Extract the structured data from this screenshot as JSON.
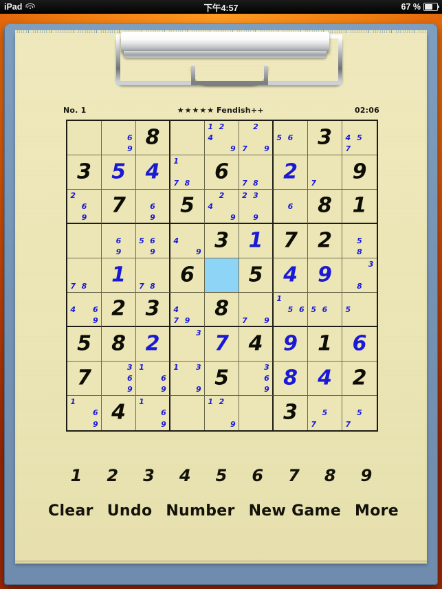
{
  "status_bar": {
    "device": "iPad",
    "wifi_icon": "wifi-icon",
    "time": "下午4:57",
    "battery_percent": "67 %",
    "battery_icon": "battery-icon"
  },
  "puzzle": {
    "number_label": "No. 1",
    "stars": "★★★★★",
    "difficulty": "Fendish++",
    "timer": "02:06",
    "selected_cell": {
      "row": 5,
      "col": 5
    },
    "colors": {
      "given": "#0d0d06",
      "user_entry": "#1a1ad6",
      "pencil_mark": "#1a1ad6",
      "selection": "#8ed4f7",
      "paper": "#ece6b6",
      "grid_line": "#1c1c14",
      "clipboard": "#7492b4",
      "desktop": "#cf4a07"
    }
  },
  "grid": [
    [
      {
        "v": null,
        "t": null,
        "m": []
      },
      {
        "v": null,
        "t": null,
        "m": [
          {
            "n": "6",
            "p": 5
          },
          {
            "n": "9",
            "p": 8
          }
        ]
      },
      {
        "v": "8",
        "t": "given",
        "m": []
      },
      {
        "v": null,
        "t": null,
        "m": []
      },
      {
        "v": null,
        "t": null,
        "m": [
          {
            "n": "1",
            "p": 0
          },
          {
            "n": "2",
            "p": 1
          },
          {
            "n": "4",
            "p": 3
          },
          {
            "n": "9",
            "p": 8
          }
        ]
      },
      {
        "v": null,
        "t": null,
        "m": [
          {
            "n": "2",
            "p": 1
          },
          {
            "n": "7",
            "p": 6
          },
          {
            "n": "9",
            "p": 8
          }
        ]
      },
      {
        "v": null,
        "t": null,
        "m": [
          {
            "n": "5",
            "p": 3
          },
          {
            "n": "6",
            "p": 4
          }
        ]
      },
      {
        "v": "3",
        "t": "given",
        "m": []
      },
      {
        "v": null,
        "t": null,
        "m": [
          {
            "n": "4",
            "p": 3
          },
          {
            "n": "5",
            "p": 4
          },
          {
            "n": "7",
            "p": 6
          }
        ]
      }
    ],
    [
      {
        "v": "3",
        "t": "given",
        "m": []
      },
      {
        "v": "5",
        "t": "user",
        "m": []
      },
      {
        "v": "4",
        "t": "user",
        "m": []
      },
      {
        "v": null,
        "t": null,
        "m": [
          {
            "n": "1",
            "p": 0
          },
          {
            "n": "7",
            "p": 6
          },
          {
            "n": "8",
            "p": 7
          }
        ]
      },
      {
        "v": "6",
        "t": "given",
        "m": []
      },
      {
        "v": null,
        "t": null,
        "m": [
          {
            "n": "7",
            "p": 6
          },
          {
            "n": "8",
            "p": 7
          }
        ]
      },
      {
        "v": "2",
        "t": "user",
        "m": []
      },
      {
        "v": null,
        "t": null,
        "m": [
          {
            "n": "7",
            "p": 6
          }
        ]
      },
      {
        "v": "9",
        "t": "given",
        "m": []
      }
    ],
    [
      {
        "v": null,
        "t": null,
        "m": [
          {
            "n": "2",
            "p": 0
          },
          {
            "n": "6",
            "p": 4
          },
          {
            "n": "9",
            "p": 7
          }
        ]
      },
      {
        "v": "7",
        "t": "given",
        "m": []
      },
      {
        "v": null,
        "t": null,
        "m": [
          {
            "n": "6",
            "p": 4
          },
          {
            "n": "9",
            "p": 7
          }
        ]
      },
      {
        "v": "5",
        "t": "given",
        "m": []
      },
      {
        "v": null,
        "t": null,
        "m": [
          {
            "n": "4",
            "p": 3
          },
          {
            "n": "2",
            "p": 1
          },
          {
            "n": "9",
            "p": 8
          }
        ]
      },
      {
        "v": null,
        "t": null,
        "m": [
          {
            "n": "2",
            "p": 0
          },
          {
            "n": "3",
            "p": 1
          },
          {
            "n": "9",
            "p": 7
          }
        ]
      },
      {
        "v": null,
        "t": null,
        "m": [
          {
            "n": "6",
            "p": 4
          }
        ]
      },
      {
        "v": "8",
        "t": "given",
        "m": []
      },
      {
        "v": "1",
        "t": "given",
        "m": []
      }
    ],
    [
      {
        "v": null,
        "t": null,
        "m": []
      },
      {
        "v": null,
        "t": null,
        "m": [
          {
            "n": "6",
            "p": 4
          },
          {
            "n": "9",
            "p": 7
          }
        ]
      },
      {
        "v": null,
        "t": null,
        "m": [
          {
            "n": "5",
            "p": 3
          },
          {
            "n": "6",
            "p": 4
          },
          {
            "n": "9",
            "p": 7
          }
        ]
      },
      {
        "v": null,
        "t": null,
        "m": [
          {
            "n": "4",
            "p": 3
          },
          {
            "n": "9",
            "p": 8
          }
        ]
      },
      {
        "v": "3",
        "t": "given",
        "m": []
      },
      {
        "v": "1",
        "t": "user",
        "m": []
      },
      {
        "v": "7",
        "t": "given",
        "m": []
      },
      {
        "v": "2",
        "t": "given",
        "m": []
      },
      {
        "v": null,
        "t": null,
        "m": [
          {
            "n": "5",
            "p": 4
          },
          {
            "n": "8",
            "p": 7
          }
        ]
      }
    ],
    [
      {
        "v": null,
        "t": null,
        "m": [
          {
            "n": "7",
            "p": 6
          },
          {
            "n": "8",
            "p": 7
          }
        ]
      },
      {
        "v": "1",
        "t": "user",
        "m": []
      },
      {
        "v": null,
        "t": null,
        "m": [
          {
            "n": "7",
            "p": 6
          },
          {
            "n": "8",
            "p": 7
          }
        ]
      },
      {
        "v": "6",
        "t": "given",
        "m": []
      },
      {
        "v": null,
        "t": null,
        "m": [],
        "sel": true
      },
      {
        "v": "5",
        "t": "given",
        "m": []
      },
      {
        "v": "4",
        "t": "user",
        "m": []
      },
      {
        "v": "9",
        "t": "user",
        "m": []
      },
      {
        "v": null,
        "t": null,
        "m": [
          {
            "n": "3",
            "p": 2
          },
          {
            "n": "8",
            "p": 7
          }
        ]
      }
    ],
    [
      {
        "v": null,
        "t": null,
        "m": [
          {
            "n": "4",
            "p": 3
          },
          {
            "n": "6",
            "p": 5
          },
          {
            "n": "9",
            "p": 8
          }
        ]
      },
      {
        "v": "2",
        "t": "given",
        "m": []
      },
      {
        "v": "3",
        "t": "given",
        "m": []
      },
      {
        "v": null,
        "t": null,
        "m": [
          {
            "n": "4",
            "p": 3
          },
          {
            "n": "7",
            "p": 6
          },
          {
            "n": "9",
            "p": 7
          }
        ]
      },
      {
        "v": "8",
        "t": "given",
        "m": []
      },
      {
        "v": null,
        "t": null,
        "m": [
          {
            "n": "7",
            "p": 6
          },
          {
            "n": "9",
            "p": 8
          }
        ]
      },
      {
        "v": null,
        "t": null,
        "m": [
          {
            "n": "1",
            "p": 0
          },
          {
            "n": "5",
            "p": 4
          },
          {
            "n": "6",
            "p": 5
          }
        ]
      },
      {
        "v": null,
        "t": null,
        "m": [
          {
            "n": "5",
            "p": 3
          },
          {
            "n": "6",
            "p": 4
          }
        ]
      },
      {
        "v": null,
        "t": null,
        "m": [
          {
            "n": "5",
            "p": 3
          }
        ]
      }
    ],
    [
      {
        "v": "5",
        "t": "given",
        "m": []
      },
      {
        "v": "8",
        "t": "given",
        "m": []
      },
      {
        "v": "2",
        "t": "user",
        "m": []
      },
      {
        "v": null,
        "t": null,
        "m": [
          {
            "n": "3",
            "p": 2
          }
        ]
      },
      {
        "v": "7",
        "t": "user",
        "m": []
      },
      {
        "v": "4",
        "t": "given",
        "m": []
      },
      {
        "v": "9",
        "t": "user",
        "m": []
      },
      {
        "v": "1",
        "t": "given",
        "m": []
      },
      {
        "v": "6",
        "t": "user",
        "m": []
      }
    ],
    [
      {
        "v": "7",
        "t": "given",
        "m": []
      },
      {
        "v": null,
        "t": null,
        "m": [
          {
            "n": "3",
            "p": 2
          },
          {
            "n": "6",
            "p": 5
          },
          {
            "n": "9",
            "p": 8
          }
        ]
      },
      {
        "v": null,
        "t": null,
        "m": [
          {
            "n": "1",
            "p": 0
          },
          {
            "n": "6",
            "p": 5
          },
          {
            "n": "9",
            "p": 8
          }
        ]
      },
      {
        "v": null,
        "t": null,
        "m": [
          {
            "n": "1",
            "p": 0
          },
          {
            "n": "3",
            "p": 2
          },
          {
            "n": "9",
            "p": 8
          }
        ]
      },
      {
        "v": "5",
        "t": "given",
        "m": []
      },
      {
        "v": null,
        "t": null,
        "m": [
          {
            "n": "3",
            "p": 2
          },
          {
            "n": "6",
            "p": 5
          },
          {
            "n": "9",
            "p": 8
          }
        ]
      },
      {
        "v": "8",
        "t": "user",
        "m": []
      },
      {
        "v": "4",
        "t": "user",
        "m": []
      },
      {
        "v": "2",
        "t": "given",
        "m": []
      }
    ],
    [
      {
        "v": null,
        "t": null,
        "m": [
          {
            "n": "1",
            "p": 0
          },
          {
            "n": "6",
            "p": 5
          },
          {
            "n": "9",
            "p": 8
          }
        ]
      },
      {
        "v": "4",
        "t": "given",
        "m": []
      },
      {
        "v": null,
        "t": null,
        "m": [
          {
            "n": "1",
            "p": 0
          },
          {
            "n": "6",
            "p": 5
          },
          {
            "n": "9",
            "p": 8
          }
        ]
      },
      {
        "v": null,
        "t": null,
        "m": []
      },
      {
        "v": null,
        "t": null,
        "m": [
          {
            "n": "1",
            "p": 0
          },
          {
            "n": "2",
            "p": 1
          },
          {
            "n": "9",
            "p": 8
          }
        ]
      },
      {
        "v": null,
        "t": null,
        "m": []
      },
      {
        "v": "3",
        "t": "given",
        "m": []
      },
      {
        "v": null,
        "t": null,
        "m": [
          {
            "n": "5",
            "p": 4
          },
          {
            "n": "7",
            "p": 6
          }
        ]
      },
      {
        "v": null,
        "t": null,
        "m": [
          {
            "n": "5",
            "p": 4
          },
          {
            "n": "7",
            "p": 6
          }
        ]
      }
    ]
  ],
  "number_pad": [
    "1",
    "2",
    "3",
    "4",
    "5",
    "6",
    "7",
    "8",
    "9"
  ],
  "actions": [
    "Clear",
    "Undo",
    "Number",
    "New Game",
    "More"
  ]
}
